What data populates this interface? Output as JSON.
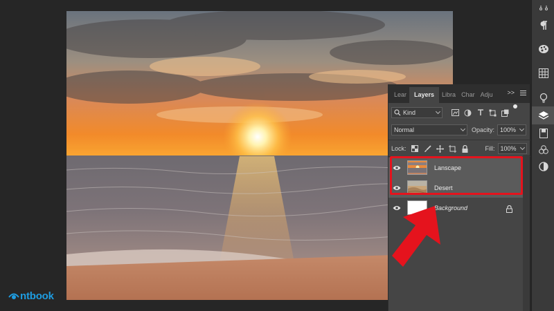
{
  "layers_panel": {
    "tabs": [
      "Lear",
      "Layers",
      "Libra",
      "Char",
      "Adju"
    ],
    "tab_overflow": ">>",
    "filter_kind": "Kind",
    "blend_mode": "Normal",
    "opacity_label": "Opacity:",
    "opacity_value": "100%",
    "lock_label": "Lock:",
    "fill_label": "Fill:",
    "fill_value": "100%",
    "layers": [
      {
        "name": "Lanscape",
        "selected": true,
        "visible": true
      },
      {
        "name": "Desert",
        "selected": true,
        "visible": true
      },
      {
        "name": "Background",
        "selected": false,
        "visible": true,
        "locked": true
      }
    ]
  },
  "toolbar_icons": [
    "graph-icon",
    "paragraph-icon",
    "palette-icon",
    "grid-icon",
    "lightbulb-icon",
    "layers-icon",
    "libraries-icon",
    "gradient-icon",
    "adjustments-icon"
  ],
  "annotation": {
    "highlight_color": "#e5131d"
  },
  "watermark": {
    "text": "ntbook",
    "color": "#1e9ce0"
  }
}
